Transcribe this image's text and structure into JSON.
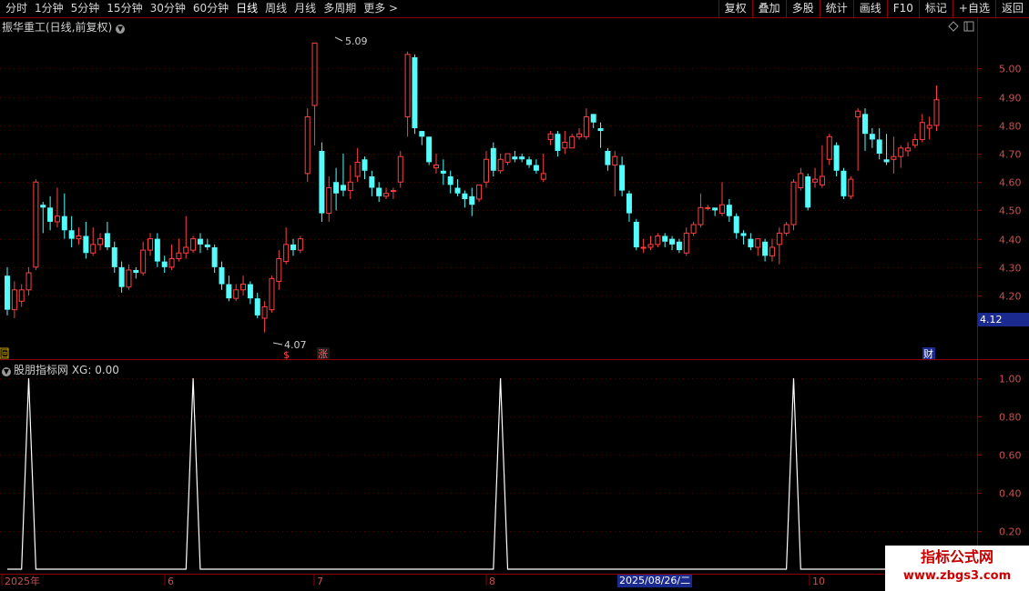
{
  "toolbar": {
    "periods": [
      "分时",
      "1分钟",
      "5分钟",
      "15分钟",
      "30分钟",
      "60分钟",
      "日线",
      "周线",
      "月线",
      "多周期",
      "更多 >"
    ],
    "active_period": "日线",
    "buttons": [
      "复权",
      "叠加",
      "多股",
      "统计",
      "画线",
      "F10",
      "标记",
      "+自选",
      "返回"
    ]
  },
  "main_chart": {
    "title": "振华重工(日线,前复权)",
    "high_label": "5.09",
    "low_label": "4.07",
    "current_price": "4.12",
    "y_ticks": [
      "5.00",
      "4.90",
      "4.80",
      "4.70",
      "4.60",
      "4.50",
      "4.40",
      "4.30",
      "4.20"
    ],
    "markers": {
      "left_box": "回",
      "dollar": "$",
      "zhang": "涨",
      "cai": "财"
    }
  },
  "indicator": {
    "title": "股朋指标网 XG: 0.00",
    "y_ticks": [
      "1.00",
      "0.80",
      "0.60",
      "0.40",
      "0.20"
    ],
    "signal_indices": [
      3,
      26,
      69,
      110
    ]
  },
  "time_axis": {
    "labels": [
      "2025年",
      "6",
      "7",
      "8",
      "10"
    ],
    "cursor_date": "2025/08/26/二"
  },
  "watermark": {
    "line1": "指标公式网",
    "line2": "www.zbgs3.com"
  },
  "colors": {
    "up": "#ff4040",
    "down": "#54fcfc",
    "grid": "#8b0000",
    "bg": "#000000"
  },
  "chart_data": {
    "type": "candlestick",
    "ylim": [
      4.12,
      5.12
    ],
    "candles": [
      [
        4.27,
        4.15,
        4.3,
        4.13
      ],
      [
        4.15,
        4.22,
        4.25,
        4.12
      ],
      [
        4.18,
        4.22,
        4.24,
        4.16
      ],
      [
        4.22,
        4.28,
        4.3,
        4.2
      ],
      [
        4.3,
        4.6,
        4.61,
        4.29
      ],
      [
        4.52,
        4.51,
        4.53,
        4.42
      ],
      [
        4.51,
        4.46,
        4.55,
        4.43
      ],
      [
        4.46,
        4.48,
        4.58,
        4.44
      ],
      [
        4.48,
        4.43,
        4.56,
        4.4
      ],
      [
        4.43,
        4.4,
        4.48,
        4.37
      ],
      [
        4.4,
        4.41,
        4.44,
        4.38
      ],
      [
        4.41,
        4.35,
        4.46,
        4.33
      ],
      [
        4.35,
        4.38,
        4.44,
        4.34
      ],
      [
        4.38,
        4.4,
        4.42,
        4.36
      ],
      [
        4.42,
        4.37,
        4.46,
        4.36
      ],
      [
        4.37,
        4.3,
        4.39,
        4.28
      ],
      [
        4.3,
        4.23,
        4.32,
        4.21
      ],
      [
        4.23,
        4.29,
        4.31,
        4.22
      ],
      [
        4.29,
        4.28,
        4.3,
        4.26
      ],
      [
        4.28,
        4.36,
        4.39,
        4.27
      ],
      [
        4.36,
        4.4,
        4.42,
        4.34
      ],
      [
        4.4,
        4.32,
        4.42,
        4.3
      ],
      [
        4.32,
        4.3,
        4.34,
        4.28
      ],
      [
        4.3,
        4.33,
        4.38,
        4.29
      ],
      [
        4.33,
        4.35,
        4.4,
        4.32
      ],
      [
        4.35,
        4.37,
        4.48,
        4.33
      ],
      [
        4.36,
        4.4,
        4.41,
        4.35
      ],
      [
        4.4,
        4.38,
        4.42,
        4.35
      ],
      [
        4.38,
        4.37,
        4.4,
        4.36
      ],
      [
        4.37,
        4.3,
        4.38,
        4.28
      ],
      [
        4.3,
        4.24,
        4.32,
        4.22
      ],
      [
        4.24,
        4.19,
        4.27,
        4.18
      ],
      [
        4.19,
        4.22,
        4.24,
        4.18
      ],
      [
        4.22,
        4.24,
        4.27,
        4.2
      ],
      [
        4.24,
        4.19,
        4.25,
        4.17
      ],
      [
        4.19,
        4.13,
        4.21,
        4.12
      ],
      [
        4.12,
        4.16,
        4.18,
        4.07
      ],
      [
        4.15,
        4.26,
        4.27,
        4.14
      ],
      [
        4.25,
        4.33,
        4.36,
        4.22
      ],
      [
        4.32,
        4.38,
        4.44,
        4.31
      ],
      [
        4.38,
        4.36,
        4.4,
        4.34
      ],
      [
        4.36,
        4.4,
        4.41,
        4.35
      ],
      [
        4.63,
        4.83,
        4.86,
        4.6
      ],
      [
        4.87,
        5.09,
        5.09,
        4.73
      ],
      [
        4.71,
        4.49,
        4.74,
        4.46
      ],
      [
        4.49,
        4.58,
        4.62,
        4.46
      ],
      [
        4.6,
        4.56,
        4.65,
        4.5
      ],
      [
        4.59,
        4.57,
        4.7,
        4.55
      ],
      [
        4.57,
        4.6,
        4.66,
        4.54
      ],
      [
        4.62,
        4.67,
        4.72,
        4.6
      ],
      [
        4.68,
        4.64,
        4.69,
        4.61
      ],
      [
        4.62,
        4.58,
        4.64,
        4.55
      ],
      [
        4.58,
        4.55,
        4.6,
        4.53
      ],
      [
        4.55,
        4.56,
        4.58,
        4.54
      ],
      [
        4.57,
        4.57,
        4.58,
        4.54
      ],
      [
        4.6,
        4.69,
        4.71,
        4.58
      ],
      [
        4.83,
        5.05,
        5.06,
        4.76
      ],
      [
        5.04,
        4.79,
        5.05,
        4.77
      ],
      [
        4.78,
        4.76,
        4.78,
        4.73
      ],
      [
        4.76,
        4.67,
        4.76,
        4.66
      ],
      [
        4.65,
        4.66,
        4.7,
        4.63
      ],
      [
        4.64,
        4.63,
        4.68,
        4.59
      ],
      [
        4.62,
        4.59,
        4.64,
        4.56
      ],
      [
        4.58,
        4.56,
        4.61,
        4.55
      ],
      [
        4.56,
        4.54,
        4.57,
        4.51
      ],
      [
        4.55,
        4.52,
        4.58,
        4.48
      ],
      [
        4.54,
        4.59,
        4.59,
        4.53
      ],
      [
        4.6,
        4.68,
        4.71,
        4.58
      ],
      [
        4.72,
        4.64,
        4.74,
        4.62
      ],
      [
        4.64,
        4.68,
        4.7,
        4.63
      ],
      [
        4.67,
        4.7,
        4.7,
        4.66
      ],
      [
        4.69,
        4.68,
        4.71,
        4.67
      ],
      [
        4.69,
        4.68,
        4.7,
        4.67
      ],
      [
        4.68,
        4.66,
        4.69,
        4.65
      ],
      [
        4.66,
        4.64,
        4.68,
        4.63
      ],
      [
        4.61,
        4.63,
        4.7,
        4.6
      ],
      [
        4.75,
        4.77,
        4.78,
        4.73
      ],
      [
        4.77,
        4.71,
        4.78,
        4.69
      ],
      [
        4.72,
        4.74,
        4.78,
        4.7
      ],
      [
        4.72,
        4.76,
        4.77,
        4.74
      ],
      [
        4.76,
        4.77,
        4.79,
        4.75
      ],
      [
        4.76,
        4.83,
        4.86,
        4.75
      ],
      [
        4.84,
        4.81,
        4.84,
        4.79
      ],
      [
        4.79,
        4.78,
        4.81,
        4.72
      ],
      [
        4.71,
        4.66,
        4.72,
        4.64
      ],
      [
        4.66,
        4.69,
        4.71,
        4.55
      ],
      [
        4.66,
        4.57,
        4.69,
        4.55
      ],
      [
        4.56,
        4.49,
        4.57,
        4.46
      ],
      [
        4.46,
        4.37,
        4.47,
        4.36
      ],
      [
        4.37,
        4.37,
        4.4,
        4.35
      ],
      [
        4.37,
        4.38,
        4.41,
        4.36
      ],
      [
        4.38,
        4.41,
        4.42,
        4.37
      ],
      [
        4.41,
        4.39,
        4.42,
        4.37
      ],
      [
        4.4,
        4.38,
        4.41,
        4.36
      ],
      [
        4.39,
        4.36,
        4.4,
        4.35
      ],
      [
        4.35,
        4.42,
        4.44,
        4.34
      ],
      [
        4.42,
        4.45,
        4.46,
        4.41
      ],
      [
        4.45,
        4.51,
        4.56,
        4.44
      ],
      [
        4.51,
        4.51,
        4.52,
        4.5
      ],
      [
        4.51,
        4.5,
        4.51,
        4.48
      ],
      [
        4.49,
        4.52,
        4.6,
        4.48
      ],
      [
        4.52,
        4.48,
        4.54,
        4.46
      ],
      [
        4.48,
        4.42,
        4.49,
        4.4
      ],
      [
        4.42,
        4.41,
        4.43,
        4.38
      ],
      [
        4.4,
        4.37,
        4.42,
        4.36
      ],
      [
        4.37,
        4.4,
        4.4,
        4.34
      ],
      [
        4.39,
        4.34,
        4.4,
        4.32
      ],
      [
        4.34,
        4.37,
        4.4,
        4.32
      ],
      [
        4.38,
        4.42,
        4.44,
        4.31
      ],
      [
        4.42,
        4.45,
        4.46,
        4.41
      ],
      [
        4.45,
        4.6,
        4.61,
        4.43
      ],
      [
        4.58,
        4.63,
        4.65,
        4.57
      ],
      [
        4.62,
        4.51,
        4.63,
        4.5
      ],
      [
        4.6,
        4.61,
        4.65,
        4.58
      ],
      [
        4.59,
        4.62,
        4.73,
        4.58
      ],
      [
        4.68,
        4.76,
        4.77,
        4.66
      ],
      [
        4.73,
        4.64,
        4.74,
        4.62
      ],
      [
        4.64,
        4.55,
        4.65,
        4.54
      ],
      [
        4.55,
        4.61,
        4.62,
        4.54
      ],
      [
        4.83,
        4.85,
        4.86,
        4.64
      ],
      [
        4.84,
        4.77,
        4.86,
        4.71
      ],
      [
        4.77,
        4.75,
        4.79,
        4.72
      ],
      [
        4.75,
        4.7,
        4.79,
        4.68
      ],
      [
        4.68,
        4.67,
        4.77,
        4.66
      ],
      [
        4.68,
        4.69,
        4.76,
        4.63
      ],
      [
        4.69,
        4.72,
        4.73,
        4.65
      ],
      [
        4.71,
        4.72,
        4.74,
        4.69
      ],
      [
        4.73,
        4.75,
        4.77,
        4.72
      ],
      [
        4.75,
        4.81,
        4.84,
        4.74
      ],
      [
        4.79,
        4.8,
        4.83,
        4.75
      ],
      [
        4.8,
        4.89,
        4.94,
        4.78
      ]
    ]
  }
}
